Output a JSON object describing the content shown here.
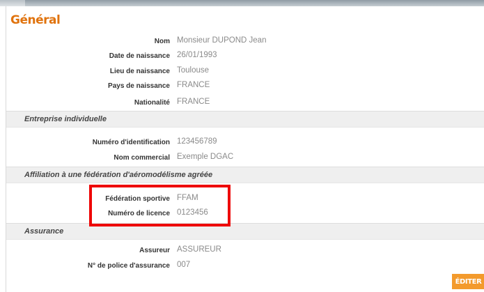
{
  "general": {
    "title": "Général",
    "fields": [
      {
        "label": "Nom",
        "value": "Monsieur DUPOND Jean"
      },
      {
        "label": "Date de naissance",
        "value": "26/01/1993"
      },
      {
        "label": "Lieu de naissance",
        "value": "Toulouse"
      },
      {
        "label": "Pays de naissance",
        "value": "FRANCE"
      },
      {
        "label": "Nationalité",
        "value": "FRANCE"
      }
    ]
  },
  "entreprise": {
    "title": "Entreprise individuelle",
    "fields": [
      {
        "label": "Numéro d'identification",
        "value": "123456789"
      },
      {
        "label": "Nom commercial",
        "value": "Exemple DGAC"
      }
    ]
  },
  "affiliation": {
    "title": "Affiliation à une fédération d'aéromodélisme agréée",
    "fields": [
      {
        "label": "Fédération sportive",
        "value": "FFAM"
      },
      {
        "label": "Numéro de licence",
        "value": "0123456"
      }
    ]
  },
  "assurance": {
    "title": "Assurance",
    "fields": [
      {
        "label": "Assureur",
        "value": "ASSUREUR"
      },
      {
        "label": "N° de police d'assurance",
        "value": "007"
      }
    ]
  },
  "actions": {
    "edit_label": "ÉDITER"
  },
  "colors": {
    "accent": "#e0730e",
    "button": "#f39a2c",
    "highlight": "#ee0505",
    "section_bg": "#efefef"
  }
}
